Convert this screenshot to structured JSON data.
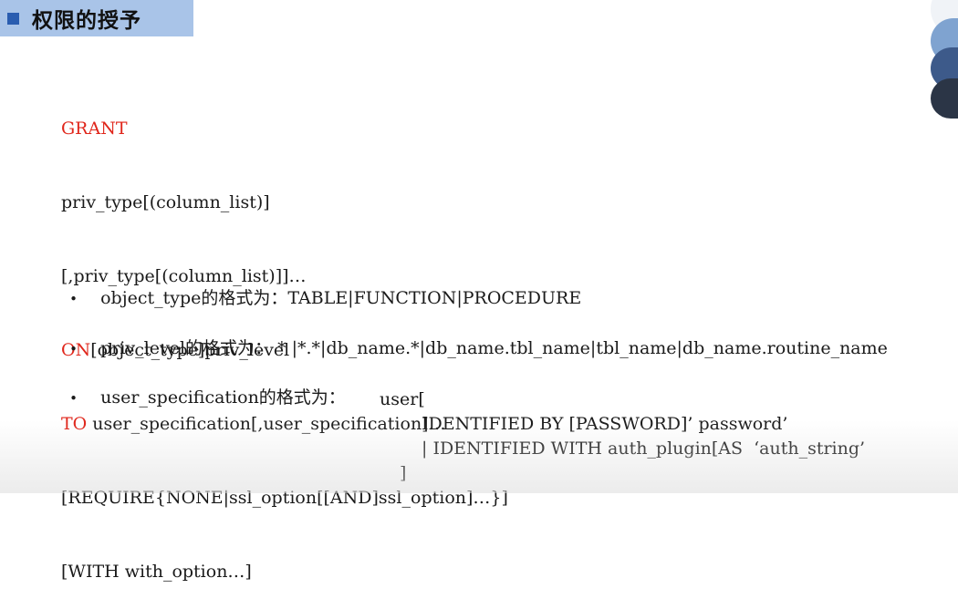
{
  "header": {
    "title": "权限的授予"
  },
  "syntax": {
    "line1_kw": "GRANT",
    "line2": "priv_type[(column_list)]",
    "line3": "[,priv_type[(column_list)]]…",
    "line4_kw": "ON",
    "line4_rest": "[object_type]priv_level",
    "line5_kw": "TO",
    "line5_rest": " user_specification[,user_specification]…",
    "line6": "[REQUIRE{NONE|ssl_option[[AND]ssl_option]…}]",
    "line7": "[WITH with_option…]"
  },
  "bullets": {
    "object_type": "object_type的格式为：TABLE|FUNCTION|PROCEDURE",
    "priv_level": "priv_level的格式为： * |*.*|db_name.*|db_name.tbl_name|tbl_name|db_name.routine_name",
    "user_spec": "user_specification的格式为："
  },
  "user_spec_detail": {
    "line1": "user[",
    "line2": "IDENTIFIED BY [PASSWORD]’ password’",
    "line3": "| IDENTIFIED WITH auth_plugin[AS  ‘auth_string’",
    "line4": "]"
  },
  "colors": {
    "keyword": "#e0261b",
    "title_bar": "#a9c4e8",
    "title_square": "#2a5db0"
  }
}
